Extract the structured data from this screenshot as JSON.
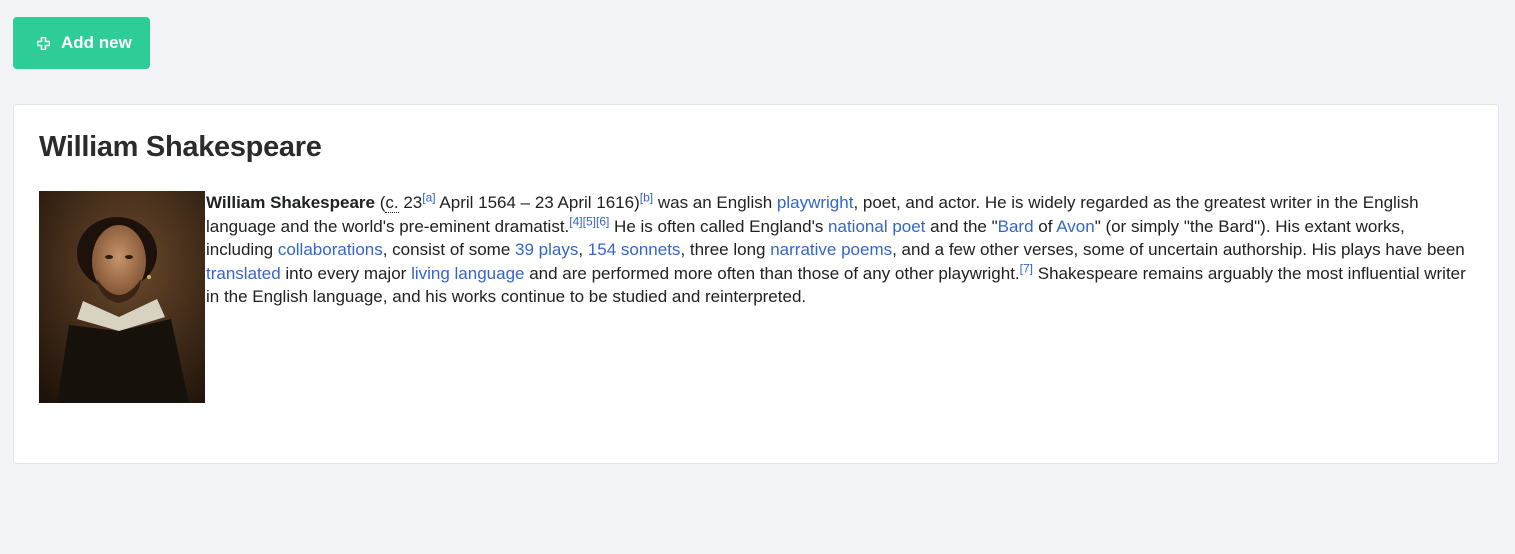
{
  "toolbar": {
    "add_button_label": "Add new",
    "add_icon": "plus-icon"
  },
  "article": {
    "title": "William Shakespeare",
    "portrait_icon": "portrait-image",
    "link_color": "#3366cc",
    "button_color": "#2ecc96",
    "segments": {
      "bold_name": "William Shakespeare",
      "t1": " (",
      "circa": "c.",
      "t2": " 23",
      "ref_a": "[a]",
      "t3": " April 1564 – 23 April 1616)",
      "ref_b": "[b]",
      "t4": " was an English ",
      "link_playwright": "playwright",
      "t5": ", poet, and actor. He is widely regarded as the greatest writer in the English language and the world's pre-eminent dramatist.",
      "ref_4": "[4]",
      "ref_5": "[5]",
      "ref_6": "[6]",
      "t6": " He is often called England's ",
      "link_national_poet": "national poet",
      "t7": " and the \"",
      "link_bard": "Bard",
      "t8": " of ",
      "link_avon": "Avon",
      "t9": "\" (or simply \"the Bard\"). His extant works, including ",
      "link_collaborations": "collaborations",
      "t10": ", consist of some ",
      "link_39_plays": "39 plays",
      "t11": ", ",
      "link_154_sonnets": "154 sonnets",
      "t12": ", three long ",
      "link_narrative_poems": "narrative poems",
      "t13": ", and a few other verses, some of uncertain authorship. His plays have been ",
      "link_translated": "translated",
      "t14": " into every major ",
      "link_living_language": "living language",
      "t15": " and are performed more often than those of any other playwright.",
      "ref_7": "[7]",
      "t16": " Shakespeare remains arguably the most influential writer in the English language, and his works continue to be studied and reinterpreted."
    }
  }
}
